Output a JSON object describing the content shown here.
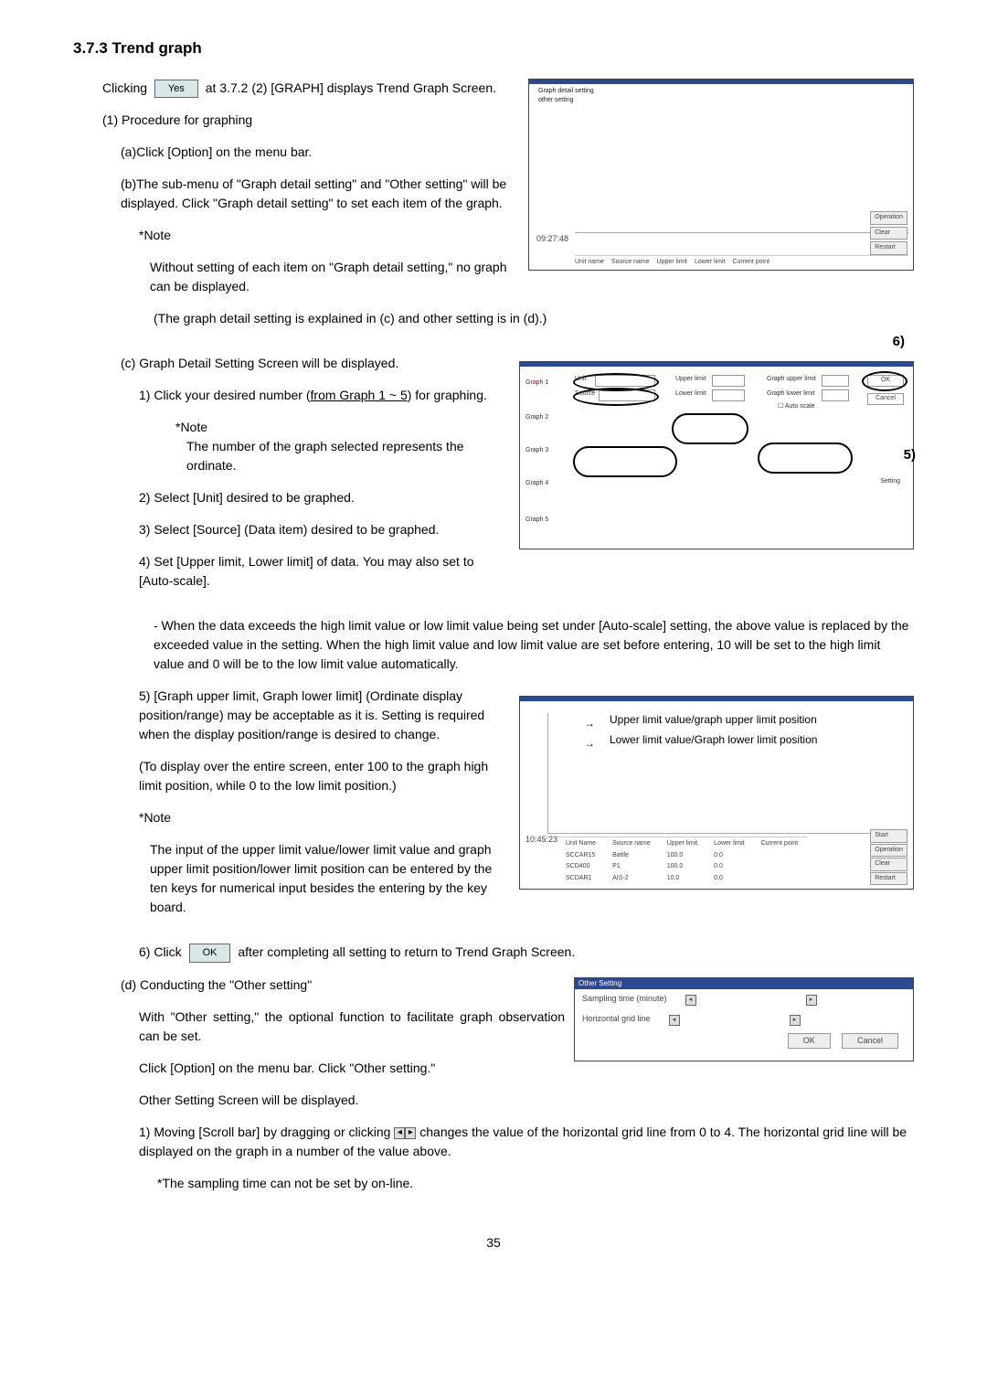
{
  "heading": "3.7.3 Trend graph",
  "intro": {
    "prefix": "Clicking",
    "btn_yes": "Yes",
    "suffix": "at 3.7.2 (2) [GRAPH] displays Trend Graph Screen."
  },
  "proc_title": "(1)  Procedure for graphing",
  "a": "(a)Click [Option] on the menu bar.",
  "b": "(b)The sub-menu of \"Graph detail setting\" and \"Other setting\" will be displayed. Click \"Graph detail setting\" to set each item of the graph.",
  "note1_label": "*Note",
  "note1_body1": "Without setting of each item on \"Graph detail setting,\" no graph can be displayed.",
  "note1_body2": "(The graph detail setting is explained in (c) and other setting is in (d).)",
  "c_head": "(c) Graph Detail Setting Screen will be displayed.",
  "c1a": "1) Click your desired number (",
  "c1_underline": "from Graph 1 ~ 5",
  "c1b": ") for graphing.",
  "c1_note_lbl": "*Note",
  "c1_note_body": "The number of the graph selected represents the ordinate.",
  "c2": "2) Select [Unit] desired to be graphed.",
  "c3": "3) Select [Source] (Data item) desired to be graphed.",
  "c4": "4) Set [Upper limit, Lower limit] of data. You may also set to [Auto-scale].",
  "c_dash": "- When the data exceeds the high limit value or low limit value being set under [Auto-scale] setting, the above value is replaced by the exceeded value in the setting. When the high limit value and low limit value are set before entering, 10 will be set to the high limit value and 0 will be to the low limit value automatically.",
  "c5": "5) [Graph upper limit, Graph lower limit] (Ordinate display position/range) may be acceptable as it is. Setting is required when the display position/range is desired to change.",
  "c5_b": "(To display over the entire screen, enter 100 to the graph high limit position, while 0 to the low limit position.)",
  "c5_note_lbl": "*Note",
  "c5_note_body": "The input of the upper limit value/lower limit value and graph upper limit position/lower limit position can be entered by the ten keys for numerical input besides the entering by the key board.",
  "c6a": "6) Click",
  "c6_btn": "OK",
  "c6b": "after completing all setting to return to Trend Graph Screen.",
  "d_head": "(d) Conducting the \"Other setting\"",
  "d_body1": "With \"Other setting,\" the optional function to facilitate graph observation can be set.",
  "d_body2": "Click [Option] on the menu bar. Click \"Other setting.\"",
  "d_body3": "Other Setting Screen will be displayed.",
  "d1a": "1)   Moving [Scroll bar] by dragging or clicking",
  "d1b": "changes the value of the horizontal grid line from 0 to 4. The horizontal grid line will be displayed on the graph in a number of the value above.",
  "d1_note": "*The sampling time can not be set by on-line.",
  "page": "35",
  "fig1": {
    "menu": "Graph detail setting\nother setting",
    "time": "09:27:48",
    "cols": [
      "Unit name",
      "Source name",
      "Upper limit",
      "Lower limit",
      "Current point"
    ],
    "btns": [
      "Operation",
      "Clear",
      "Restart"
    ]
  },
  "fig2": {
    "callout6": "6)",
    "callout5": "5)",
    "glabels": [
      "Graph 1",
      "Graph 2",
      "Graph 3",
      "Graph 4",
      "Graph 5"
    ],
    "fields": {
      "unit": "Unit",
      "source": "Source",
      "upper": "Upper limit",
      "lower": "Lower limit",
      "gup": "Graph upper limit",
      "glo": "Graph lower limit",
      "auto": "Auto scale"
    },
    "ok": "OK",
    "cancel": "Cancel",
    "setting": "Setting"
  },
  "fig3": {
    "annot_upper": "Upper limit value/graph upper limit position",
    "annot_lower": "Lower limit value/Graph lower limit position",
    "time": "10:45:23",
    "headers": [
      "Unit Name",
      "Source name",
      "Upper limit",
      "Lower limit",
      "Current point"
    ],
    "rows": [
      [
        "SCCAR15",
        "Battle",
        "100.0",
        "0.0",
        ""
      ],
      [
        "SCD400",
        "P1",
        "100.0",
        "0.0",
        ""
      ],
      [
        "SCDAR1",
        "AIS-2",
        "10.0",
        "0.0",
        ""
      ]
    ],
    "btns": [
      "Start",
      "Operation",
      "Clear",
      "Restart"
    ]
  },
  "fig4": {
    "title": "Other Setting",
    "row1": "Sampling time (minute)",
    "row2": "Horizontal grid line",
    "ok": "OK",
    "cancel": "Cancel"
  }
}
